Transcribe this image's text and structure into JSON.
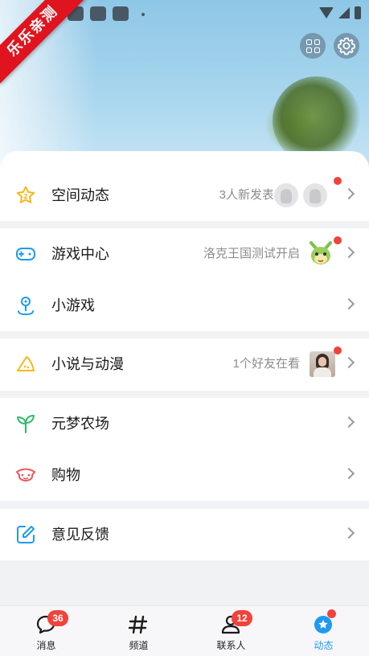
{
  "watermark": "乐乐亲测",
  "menu": {
    "qzone": {
      "label": "空间动态",
      "sub": "3人新发表"
    },
    "game_center": {
      "label": "游戏中心",
      "sub": "洛克王国测试开启"
    },
    "mini_games": {
      "label": "小游戏"
    },
    "novels": {
      "label": "小说与动漫",
      "sub": "1个好友在看"
    },
    "farm": {
      "label": "元梦农场"
    },
    "shopping": {
      "label": "购物"
    },
    "feedback": {
      "label": "意见反馈"
    }
  },
  "tabs": [
    {
      "label": "消息",
      "badge": "36"
    },
    {
      "label": "频道"
    },
    {
      "label": "联系人",
      "badge": "12"
    },
    {
      "label": "动态"
    }
  ],
  "colors": {
    "accent": "#1e9bf0",
    "badge": "#f2423a",
    "qzone_icon": "#f7b718",
    "game_icon": "#1e9bf0",
    "novel_icon": "#f7b718",
    "farm_icon": "#2ebd6b",
    "shop_icon": "#f2545b",
    "feedback_icon": "#1e9bf0"
  }
}
